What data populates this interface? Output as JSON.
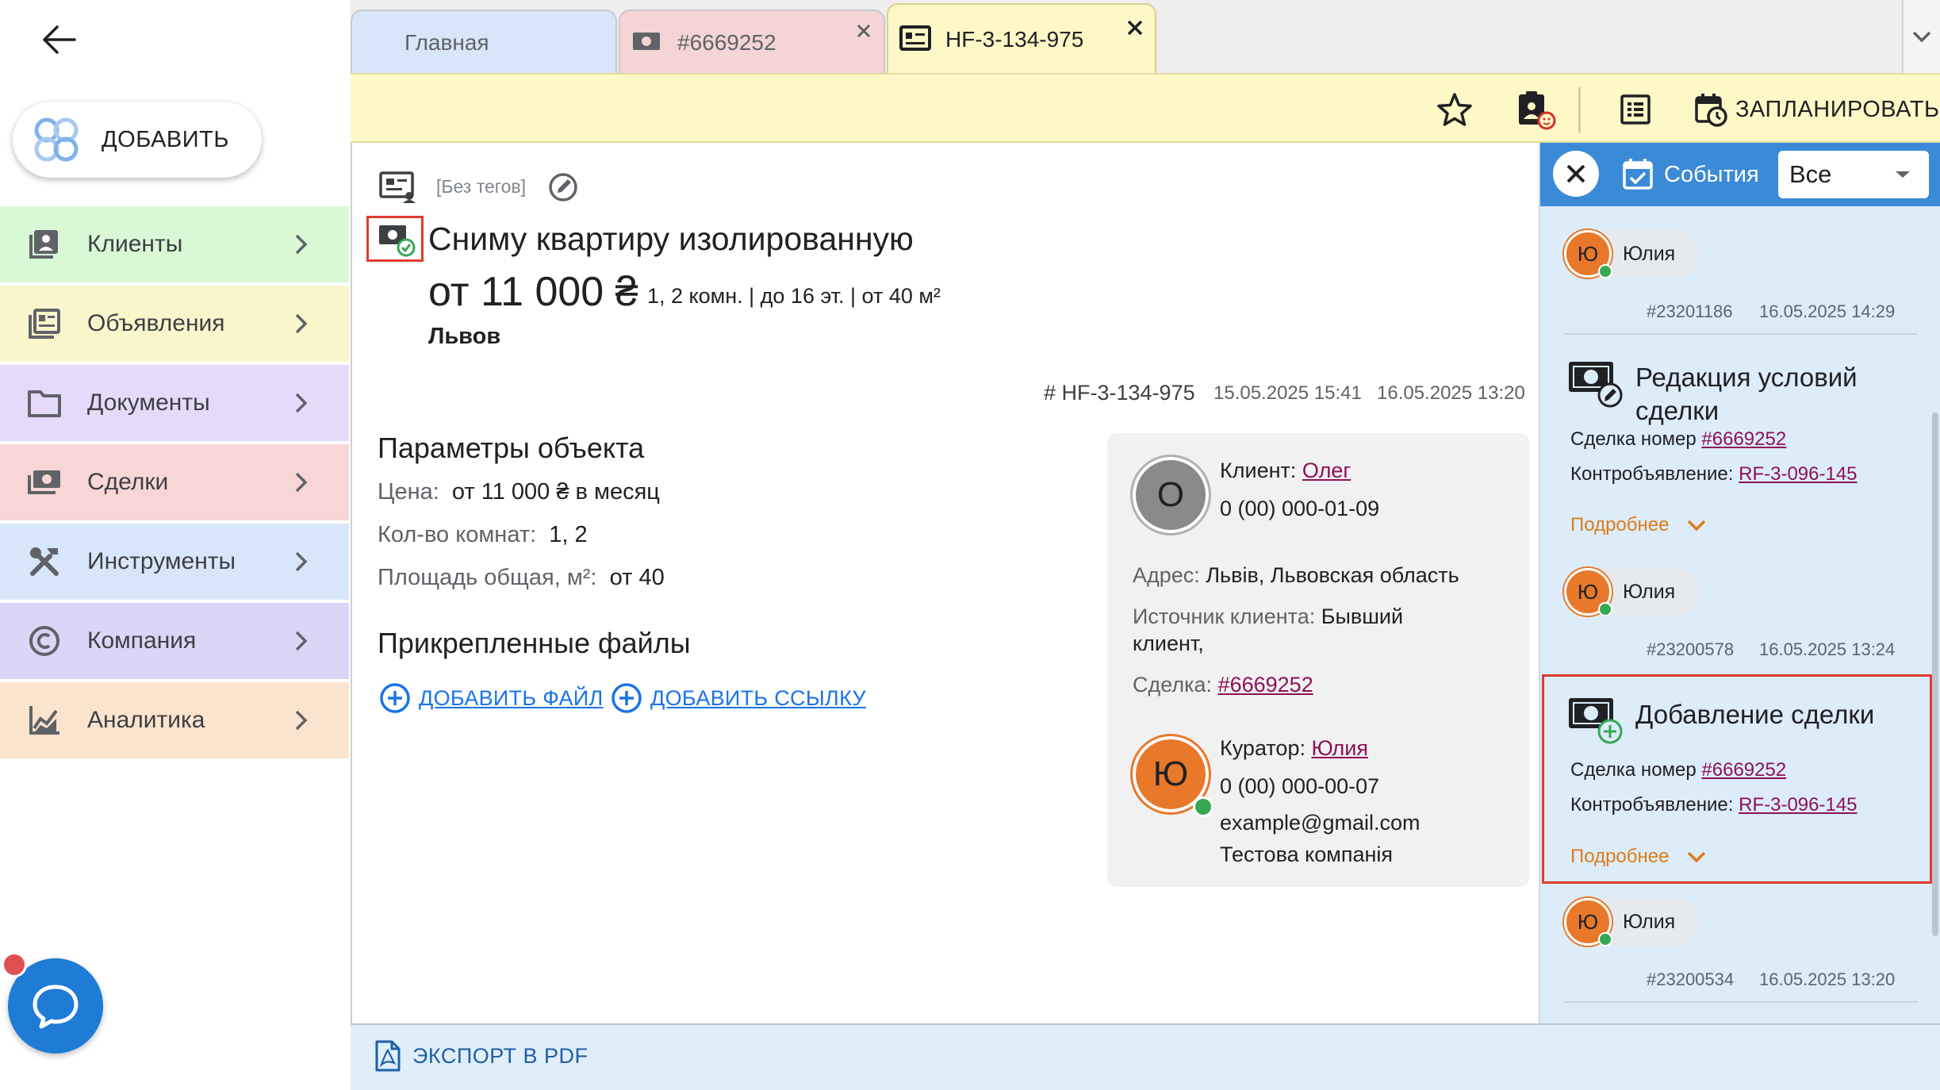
{
  "sidebar": {
    "add_label": "ДОБАВИТЬ",
    "items": [
      {
        "label": "Клиенты",
        "bg": "#d9f8d6"
      },
      {
        "label": "Объявления",
        "bg": "#f9f6cc"
      },
      {
        "label": "Документы",
        "bg": "#e6dafa"
      },
      {
        "label": "Сделки",
        "bg": "#f8d6d6"
      },
      {
        "label": "Инструменты",
        "bg": "#d8e6fa"
      },
      {
        "label": "Компания",
        "bg": "#dbd6f6"
      },
      {
        "label": "Аналитика",
        "bg": "#fbe3cd"
      }
    ]
  },
  "tabs": [
    {
      "label": "Главная",
      "bg": "#d7e6f8"
    },
    {
      "label": "#6669252",
      "bg": "#f4d4d4"
    },
    {
      "label": "HF-3-134-975",
      "bg": "#fdf8c6"
    }
  ],
  "toolbar": {
    "schedule_label": "ЗАПЛАНИРОВАТЬ"
  },
  "listing": {
    "tags": "[Без тегов]",
    "title": "Сниму квартиру изолированную",
    "price": "от 11 000 ₴",
    "specs": "1, 2 комн. | до 16 эт. | от 40 м²",
    "city": "Львов",
    "id": "# HF-3-134-975",
    "date_updated": "15.05.2025 15:41",
    "date_created": "16.05.2025 13:20"
  },
  "params": {
    "title": "Параметры объекта",
    "rows": [
      {
        "label": "Цена:",
        "value": "от 11 000 ₴ в месяц"
      },
      {
        "label": "Кол-во комнат:",
        "value": "1, 2"
      },
      {
        "label": "Площадь общая, м²:",
        "value": "от 40"
      }
    ]
  },
  "files": {
    "title": "Прикрепленные файлы",
    "add_file": "ДОБАВИТЬ ФАЙЛ",
    "add_link": "ДОБАВИТЬ ССЫЛКУ"
  },
  "card": {
    "client_label": "Клиент:",
    "client_name": "Олег",
    "client_initial": "О",
    "client_phone": "0 (00) 000-01-09",
    "address_label": "Адрес:",
    "address": "Львів, Львовская область",
    "source_label": "Источник клиента:",
    "source_line1": "Бывший",
    "source_line2": "клиент,",
    "deal_label": "Сделка:",
    "deal": "#6669252",
    "curator_label": "Куратор:",
    "curator_name": "Юлия",
    "curator_initial": "Ю",
    "curator_phone": "0 (00) 000-00-07",
    "curator_email": "example@gmail.com",
    "curator_company": "Тестова компанія"
  },
  "events": {
    "tab_label": "События",
    "filter_value": "Все",
    "items": [
      {
        "user": "Юлия",
        "initial": "Ю",
        "num": "#23201186",
        "date": "16.05.2025 14:29"
      },
      {
        "title_l1": "Редакция условий",
        "title_l2": "сделки",
        "deal_label": "Сделка номер",
        "deal": "#6669252",
        "counter_label": "Контробъявление:",
        "counter": "RF-3-096-145",
        "more": "Подробнее",
        "user": "Юлия",
        "initial": "Ю",
        "num": "#23200578",
        "date": "16.05.2025 13:24"
      },
      {
        "title_l1": "Добавление сделки",
        "deal_label": "Сделка номер",
        "deal": "#6669252",
        "counter_label": "Контробъявление:",
        "counter": "RF-3-096-145",
        "more": "Подробнее",
        "user": "Юлия",
        "initial": "Ю",
        "num": "#23200534",
        "date": "16.05.2025 13:20"
      }
    ]
  },
  "bottom": {
    "pdf_label": "ЭКСПОРТ В PDF"
  },
  "colors": {
    "accent_blue": "#3a8ad8",
    "highlight_red": "#e03b2f",
    "more_orange": "#e07b17",
    "avatar_orange": "#e8782a",
    "online_green": "#34a853"
  }
}
